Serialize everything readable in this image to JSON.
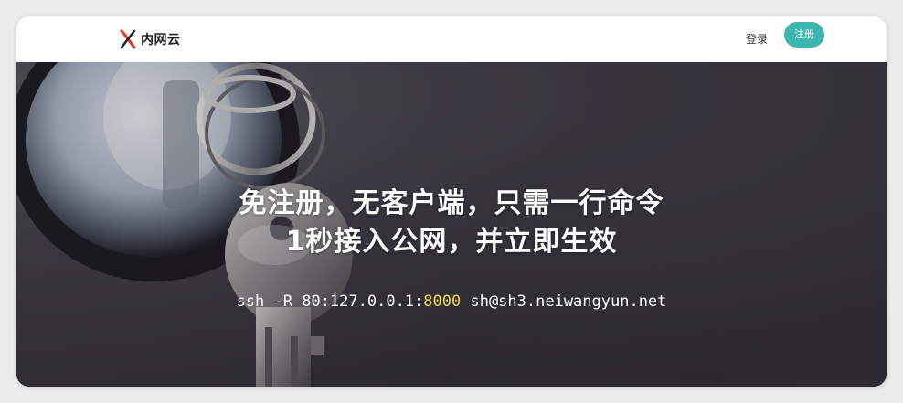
{
  "brand": {
    "name": "内网云",
    "logo_icon": "x-logo-icon",
    "logo_colors": [
      "#d8402f",
      "#1a1a1a"
    ]
  },
  "nav": {
    "login_label": "登录",
    "register_label": "注册",
    "register_color": "#3fb5b0"
  },
  "hero": {
    "title_line1": "免注册，无客户端，只需一行命令",
    "title_line2": "1秒接入公网，并立即生效",
    "command": {
      "prefix": "ssh -R 80:127.0.0.1:",
      "port": "8000",
      "suffix": " sh@sh3.neiwangyun.net",
      "port_color": "#f2d74a"
    },
    "background_image": "key-in-lock-photo"
  }
}
